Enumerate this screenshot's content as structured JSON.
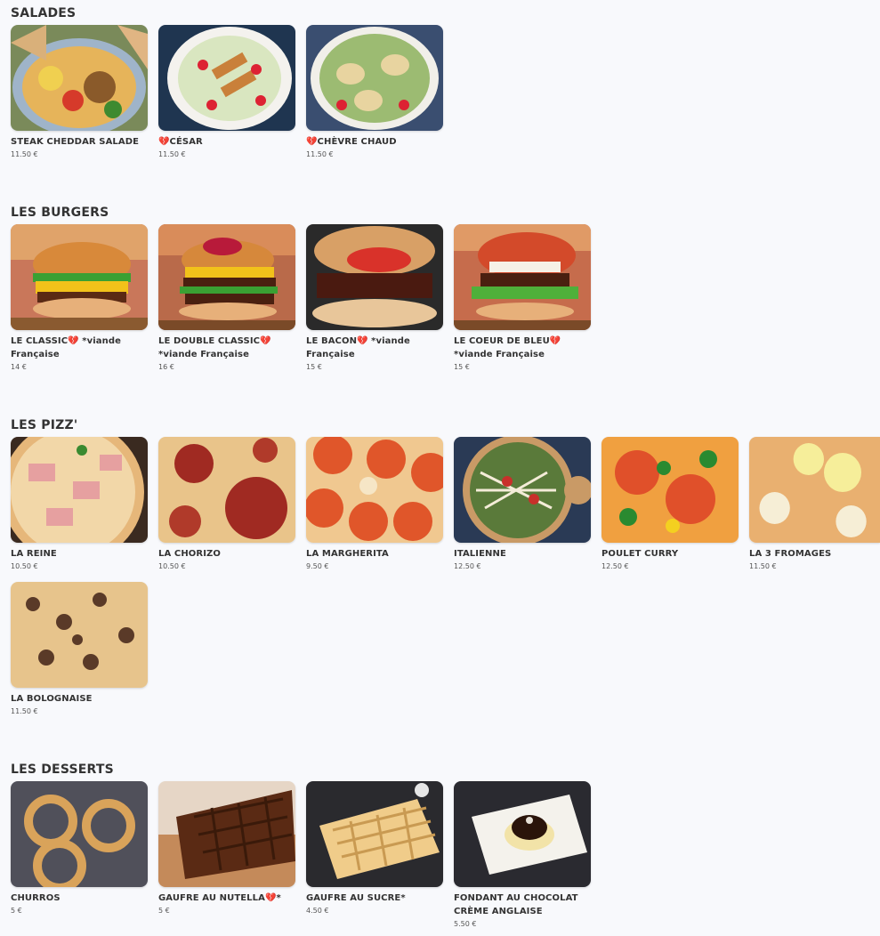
{
  "sections": {
    "salades": {
      "title": "SALADES",
      "items": [
        {
          "name": "STEAK CHEDDAR SALADE",
          "price": "11.50 €"
        },
        {
          "name": "💔CÉSAR",
          "price": "11.50 €"
        },
        {
          "name": "💔CHÈVRE CHAUD",
          "price": "11.50 €"
        }
      ]
    },
    "burgers": {
      "title": "LES BURGERS",
      "items": [
        {
          "name": "LE CLASSIC💔 *viande Française",
          "price": "14 €"
        },
        {
          "name": "LE DOUBLE CLASSIC💔 *viande Française",
          "price": "16 €"
        },
        {
          "name": "LE BACON💔 *viande Française",
          "price": "15 €"
        },
        {
          "name": "LE COEUR DE BLEU💔 *viande Française",
          "price": "15 €"
        }
      ]
    },
    "pizzas": {
      "title": "LES PIZZ'",
      "items": [
        {
          "name": "LA REINE",
          "price": "10.50 €"
        },
        {
          "name": "LA CHORIZO",
          "price": "10.50 €"
        },
        {
          "name": "LA MARGHERITA",
          "price": "9.50 €"
        },
        {
          "name": "ITALIENNE",
          "price": "12.50 €"
        },
        {
          "name": "POULET CURRY",
          "price": "12.50 €"
        },
        {
          "name": "LA 3 FROMAGES",
          "price": "11.50 €"
        },
        {
          "name": "LA BOLOGNAISE",
          "price": "11.50 €"
        }
      ]
    },
    "desserts": {
      "title": "LES DESSERTS",
      "items": [
        {
          "name": "CHURROS",
          "price": "5 €"
        },
        {
          "name": "GAUFRE AU NUTELLA💔*",
          "price": "5 €"
        },
        {
          "name": "GAUFRE AU SUCRE*",
          "price": "4.50 €"
        },
        {
          "name": "FONDANT AU CHOCOLAT CRÈME ANGLAISE",
          "price": "5.50 €"
        }
      ]
    }
  },
  "icons": {
    "salad-photo": "salad-bowl",
    "burger-photo": "burger",
    "pizza-photo": "pizza",
    "dessert-photo": "dessert"
  },
  "colors": {
    "background": "#f8f9fc",
    "heading": "#333333"
  }
}
